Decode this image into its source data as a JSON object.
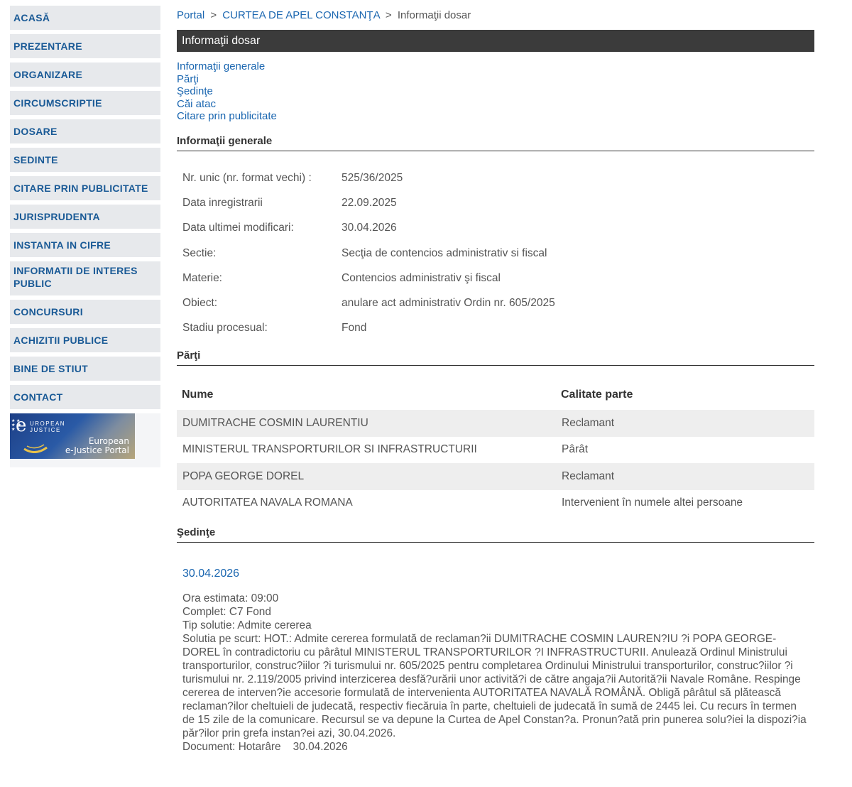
{
  "sidebar": {
    "items": [
      {
        "label": "ACASĂ"
      },
      {
        "label": "PREZENTARE"
      },
      {
        "label": "ORGANIZARE"
      },
      {
        "label": "CIRCUMSCRIPTIE"
      },
      {
        "label": "DOSARE"
      },
      {
        "label": "SEDINTE"
      },
      {
        "label": "CITARE PRIN PUBLICITATE"
      },
      {
        "label": "JURISPRUDENTA"
      },
      {
        "label": "INSTANTA IN CIFRE"
      },
      {
        "label": "INFORMATII DE INTERES PUBLIC"
      },
      {
        "label": "CONCURSURI"
      },
      {
        "label": "ACHIZITII PUBLICE"
      },
      {
        "label": "BINE DE STIUT"
      },
      {
        "label": "CONTACT"
      }
    ],
    "ejustice": {
      "top": "UROPEAN",
      "top2": "JUSTICE",
      "line1": "European",
      "line2": "e-Justice Portal"
    }
  },
  "breadcrumb": {
    "portal": "Portal",
    "court": "CURTEA DE APEL CONSTANŢA",
    "current": "Informaţii dosar",
    "sep": ">"
  },
  "title": "Informaţii dosar",
  "anchors": [
    "Informaţii generale",
    "Părţi",
    "Şedinţe",
    "Căi atac",
    "Citare prin publicitate"
  ],
  "general": {
    "heading": "Informaţii generale",
    "rows": [
      {
        "label": "Nr. unic (nr. format vechi) :",
        "value": "525/36/2025"
      },
      {
        "label": "Data inregistrarii",
        "value": "22.09.2025"
      },
      {
        "label": "Data ultimei modificari:",
        "value": "30.04.2026"
      },
      {
        "label": "Sectie:",
        "value": "Secţia de contencios administrativ si fiscal"
      },
      {
        "label": "Materie:",
        "value": "Contencios administrativ şi fiscal"
      },
      {
        "label": "Obiect:",
        "value": "anulare act administrativ Ordin nr. 605/2025"
      },
      {
        "label": "Stadiu procesual:",
        "value": "Fond"
      }
    ]
  },
  "parties": {
    "heading": "Părţi",
    "col_name": "Nume",
    "col_role": "Calitate parte",
    "rows": [
      {
        "name": "DUMITRACHE COSMIN LAURENTIU",
        "role": "Reclamant"
      },
      {
        "name": "MINISTERUL TRANSPORTURILOR SI INFRASTRUCTURII",
        "role": "Pârât"
      },
      {
        "name": "POPA GEORGE DOREL",
        "role": "Reclamant"
      },
      {
        "name": "AUTORITATEA NAVALA ROMANA",
        "role": "Intervenient în numele altei persoane"
      }
    ]
  },
  "hearings": {
    "heading": "Şedinţe",
    "date": "30.04.2026",
    "lines": [
      "Ora estimata: 09:00",
      "Complet: C7 Fond",
      "Tip solutie: Admite cererea",
      "Solutia pe scurt: HOT.: Admite cererea formulată de reclaman?ii DUMITRACHE COSMIN LAUREN?IU ?i POPA GEORGE-DOREL în contradictoriu cu pârâtul MINISTERUL TRANSPORTURILOR ?I INFRASTRUCTURII. Anulează Ordinul Ministrului transporturilor, construc?iilor ?i turismului nr. 605/2025 pentru completarea Ordinului Ministrului transporturilor, construc?iilor ?i turismului nr. 2.119/2005 privind interzicerea desfă?urării unor activită?i de către angaja?ii Autorită?ii Navale Române. Respinge cererea de interven?ie accesorie formulată de intervenienta AUTORITATEA NAVALĂ ROMÂNĂ. Obligă pârâtul să plătească reclaman?ilor cheltuieli de judecată, respectiv fiecăruia în parte, cheltuieli de judecată în sumă de 2445 lei. Cu recurs în termen de 15 zile de la comunicare. Recursul se va depune la Curtea de Apel Constan?a. Pronun?ată prin punerea solu?iei la dispozi?ia păr?ilor prin grefa instan?ei azi, 30.04.2026.",
      "Document: Hotarâre    30.04.2026"
    ]
  }
}
